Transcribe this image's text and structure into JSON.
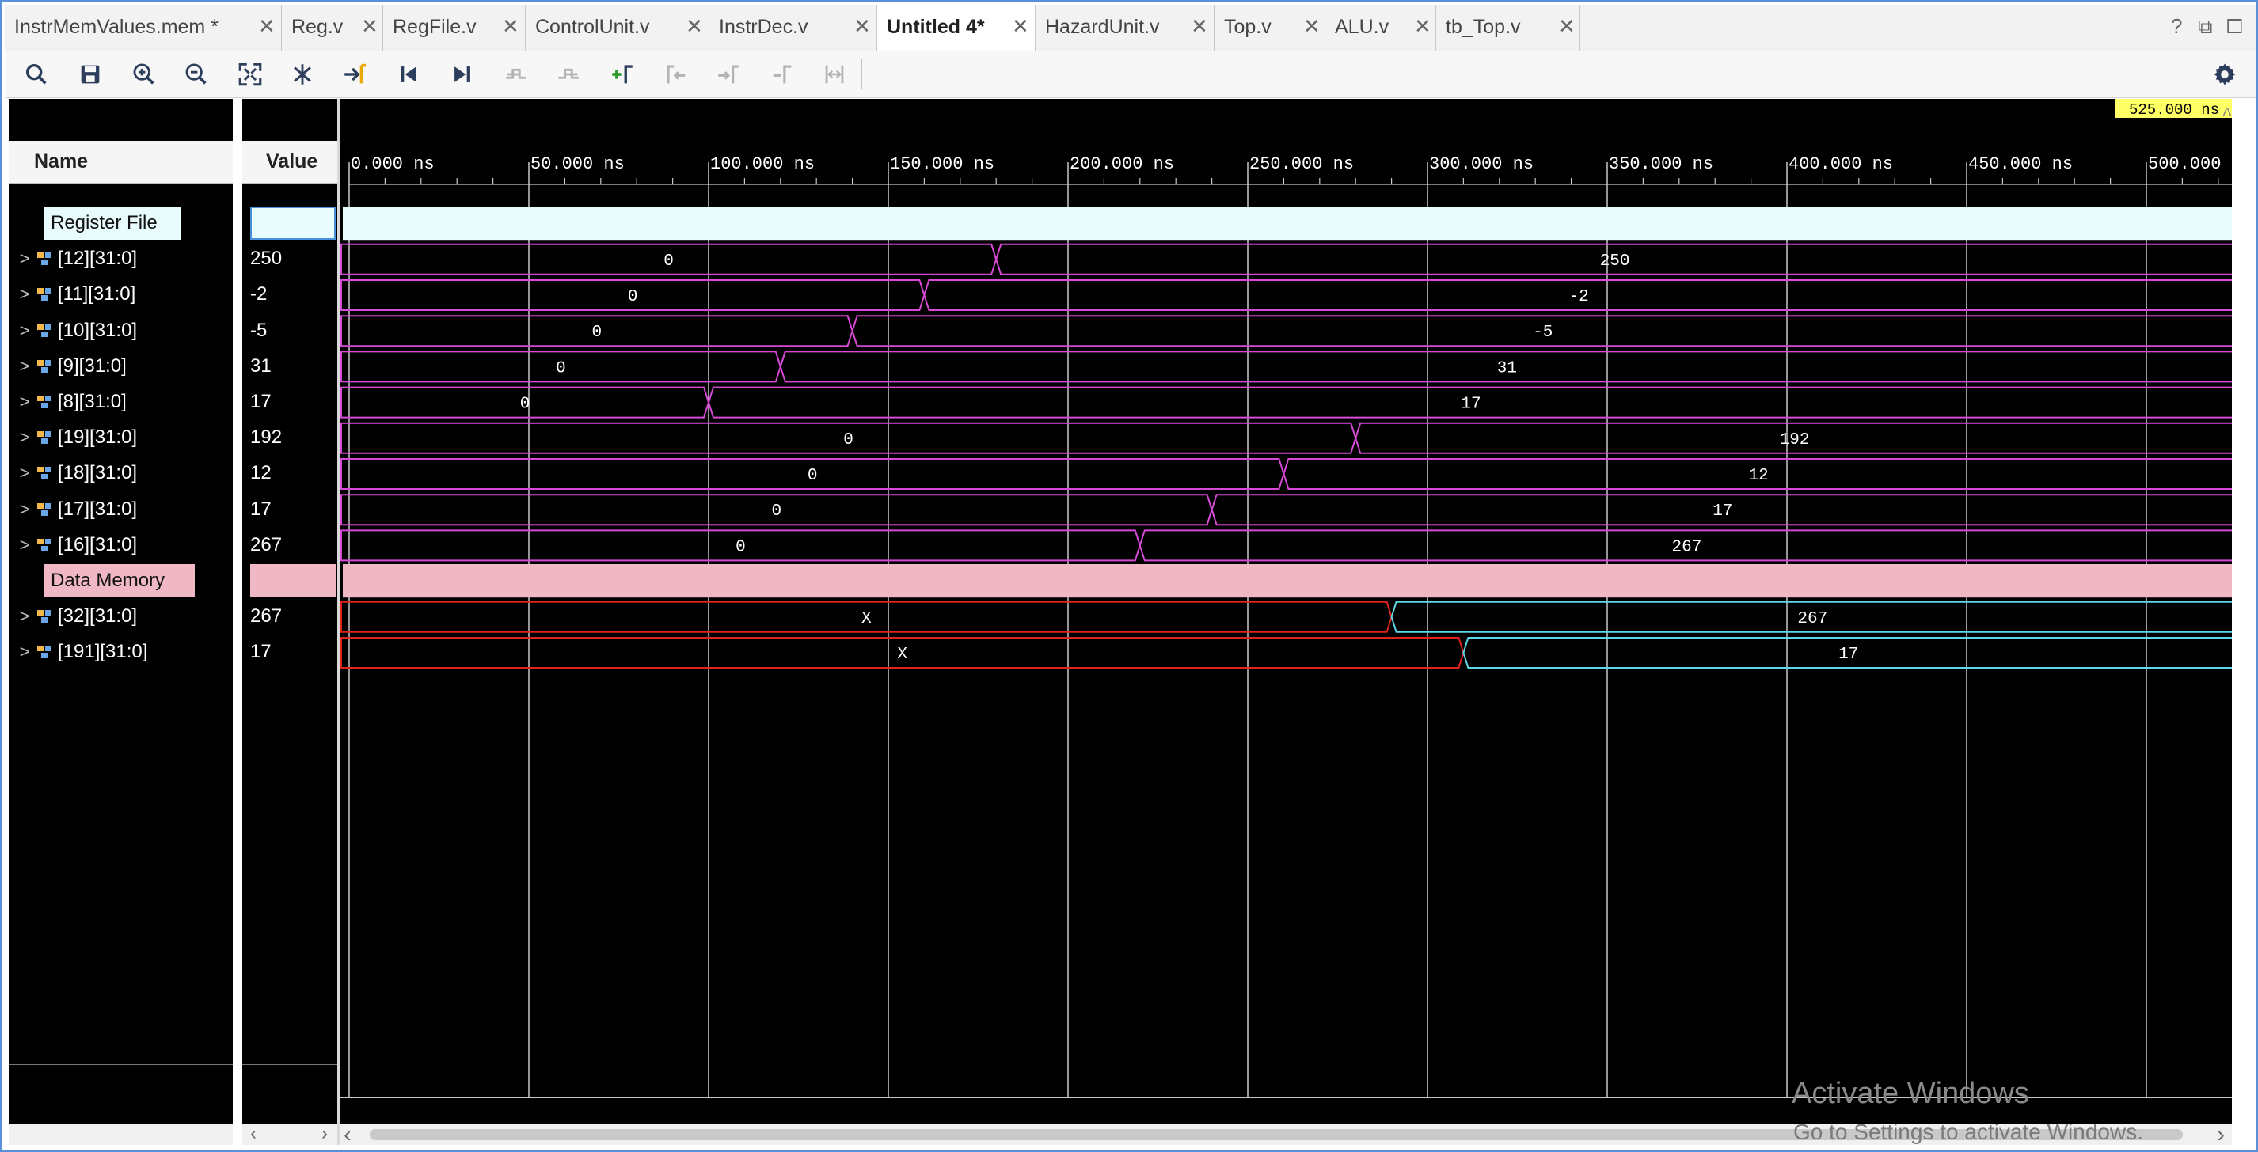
{
  "tabs": [
    {
      "label": "InstrMemValues.mem *"
    },
    {
      "label": "Reg.v"
    },
    {
      "label": "RegFile.v"
    },
    {
      "label": "ControlUnit.v"
    },
    {
      "label": "InstrDec.v"
    },
    {
      "label": "Untitled 4*",
      "active": true
    },
    {
      "label": "HazardUnit.v"
    },
    {
      "label": "Top.v"
    },
    {
      "label": "ALU.v"
    },
    {
      "label": "tb_Top.v"
    }
  ],
  "window_controls": {
    "help": "?",
    "restore": "⧉",
    "maximize": "⧠"
  },
  "toolbar_icons": [
    "search-icon",
    "save-icon",
    "zoom-in-icon",
    "zoom-out-icon",
    "zoom-fit-icon",
    "cursor-marker-icon",
    "go-to-cursor-icon",
    "go-to-start-icon",
    "go-to-end-icon",
    "previous-transition-icon",
    "next-transition-icon",
    "add-marker-icon",
    "previous-marker-icon",
    "next-marker-icon",
    "swap-cursors-icon",
    "snap-to-transition-icon",
    "settings-gear-icon"
  ],
  "headers": {
    "name": "Name",
    "value": "Value"
  },
  "cursor_time": "525.000 ns",
  "time_axis": {
    "ticks": [
      "0.000 ns",
      "50.000 ns",
      "100.000 ns",
      "150.000 ns",
      "200.000 ns",
      "250.000 ns",
      "300.000 ns",
      "350.000 ns",
      "400.000 ns",
      "450.000 ns",
      "500.000 ns"
    ],
    "unit": "ns"
  },
  "groups": {
    "register_file": {
      "label": "Register File",
      "color": "#e8fbfd"
    },
    "data_memory": {
      "label": "Data Memory",
      "color": "#f0b8c4"
    }
  },
  "colors": {
    "reg_wave": "#d64ad6",
    "mem_x_wave": "#e0231b",
    "mem_val_wave": "#5fd9e8"
  },
  "signals": [
    {
      "name": "[12][31:0]",
      "value": "250",
      "group": "register_file",
      "transition_ns": 180,
      "before": "0",
      "after": "250"
    },
    {
      "name": "[11][31:0]",
      "value": "-2",
      "group": "register_file",
      "transition_ns": 160,
      "before": "0",
      "after": "-2"
    },
    {
      "name": "[10][31:0]",
      "value": "-5",
      "group": "register_file",
      "transition_ns": 140,
      "before": "0",
      "after": "-5"
    },
    {
      "name": "[9][31:0]",
      "value": "31",
      "group": "register_file",
      "transition_ns": 120,
      "before": "0",
      "after": "31"
    },
    {
      "name": "[8][31:0]",
      "value": "17",
      "group": "register_file",
      "transition_ns": 100,
      "before": "0",
      "after": "17"
    },
    {
      "name": "[19][31:0]",
      "value": "192",
      "group": "register_file",
      "transition_ns": 280,
      "before": "0",
      "after": "192"
    },
    {
      "name": "[18][31:0]",
      "value": "12",
      "group": "register_file",
      "transition_ns": 260,
      "before": "0",
      "after": "12"
    },
    {
      "name": "[17][31:0]",
      "value": "17",
      "group": "register_file",
      "transition_ns": 240,
      "before": "0",
      "after": "17"
    },
    {
      "name": "[16][31:0]",
      "value": "267",
      "group": "register_file",
      "transition_ns": 220,
      "before": "0",
      "after": "267"
    },
    {
      "name": "[32][31:0]",
      "value": "267",
      "group": "data_memory",
      "transition_ns": 290,
      "before": "X",
      "after": "267"
    },
    {
      "name": "[191][31:0]",
      "value": "17",
      "group": "data_memory",
      "transition_ns": 310,
      "before": "X",
      "after": "17"
    }
  ],
  "watermark": {
    "line1": "Activate Windows",
    "line2": "Go to Settings to activate Windows."
  }
}
